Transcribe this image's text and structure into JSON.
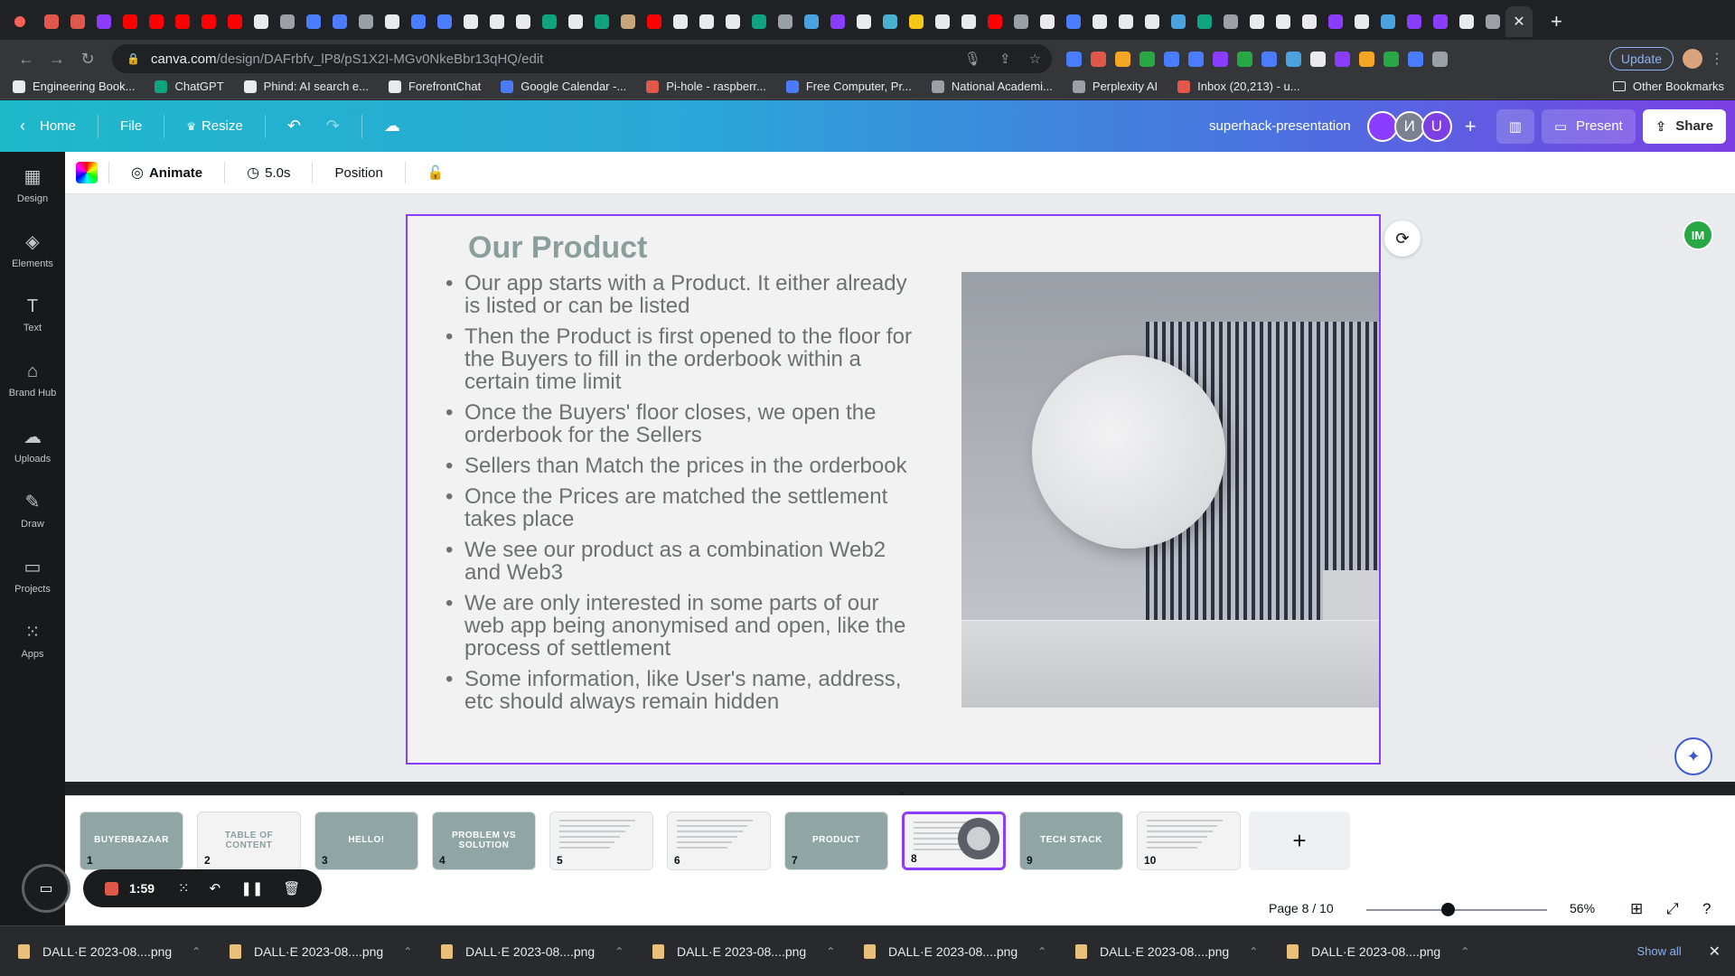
{
  "browser": {
    "url_host": "canva.com",
    "url_path": "/design/DAFrbfv_lP8/pS1X2I-MGv0NkeBbr13qHQ/edit",
    "update_label": "Update",
    "tab_favicon_colors": [
      "#e0584a",
      "#e0584a",
      "#8b3dff",
      "#ff0000",
      "#ff0000",
      "#ff0000",
      "#ff0000",
      "#ff0000",
      "#e8eaed",
      "#9aa0a6",
      "#4a7cff",
      "#4a7cff",
      "#9aa0a6",
      "#e8eaed",
      "#4a7cff",
      "#4a7cff",
      "#e8eaed",
      "#e8eaed",
      "#e8eaed",
      "#10a37f",
      "#e8eaed",
      "#10a37f",
      "#c9a67a",
      "#ff0000",
      "#e8eaed",
      "#e8eaed",
      "#e8eaed",
      "#10a37f",
      "#9aa0a6",
      "#4aa3df",
      "#8b3dff",
      "#e8eaed",
      "#4ab0d0",
      "#f5c518",
      "#e8eaed",
      "#e8eaed",
      "#ff0000",
      "#9aa0a6",
      "#e8eaed",
      "#4a7cff",
      "#e8eaed",
      "#e8eaed",
      "#e8eaed",
      "#4aa3df",
      "#10a37f",
      "#9aa0a6",
      "#e8eaed",
      "#e8eaed",
      "#e8eaed",
      "#8b3dff",
      "#e8eaed",
      "#4aa3df",
      "#8b3dff",
      "#8b3dff",
      "#e8eaed",
      "#9aa0a6"
    ],
    "extension_colors": [
      "#4a7cff",
      "#e0584a",
      "#f5a623",
      "#27a844",
      "#4a7cff",
      "#4a7cff",
      "#8b3dff",
      "#27a844",
      "#4a7cff",
      "#4aa3df",
      "#e8eaed",
      "#8b3dff",
      "#f5a623",
      "#27a844",
      "#4a7cff",
      "#9aa0a6"
    ]
  },
  "bookmarks": [
    {
      "label": "Engineering Book...",
      "color": "#e8eaed"
    },
    {
      "label": "ChatGPT",
      "color": "#10a37f"
    },
    {
      "label": "Phind: AI search e...",
      "color": "#e8eaed"
    },
    {
      "label": "ForefrontChat",
      "color": "#e8eaed"
    },
    {
      "label": "Google Calendar -...",
      "color": "#4a7cff"
    },
    {
      "label": "Pi-hole - raspberr...",
      "color": "#e0584a"
    },
    {
      "label": "Free Computer, Pr...",
      "color": "#4a7cff"
    },
    {
      "label": "National Academi...",
      "color": "#9aa0a6"
    },
    {
      "label": "Perplexity AI",
      "color": "#9aa0a6"
    },
    {
      "label": "Inbox (20,213) - u...",
      "color": "#e0584a"
    }
  ],
  "other_bookmarks": "Other Bookmarks",
  "canva_top": {
    "home": "Home",
    "file": "File",
    "resize": "Resize",
    "design_title": "superhack-presentation",
    "avatars": [
      {
        "initial": "",
        "color": "#8b3dff"
      },
      {
        "initial": "И",
        "color": "#7b8190"
      },
      {
        "initial": "U",
        "color": "#7b3fe4"
      }
    ],
    "add_label": "+",
    "present": "Present",
    "share": "Share"
  },
  "sidebar": [
    {
      "label": "Design",
      "icon": "▦"
    },
    {
      "label": "Elements",
      "icon": "◈"
    },
    {
      "label": "Text",
      "icon": "T"
    },
    {
      "label": "Brand Hub",
      "icon": "⌂"
    },
    {
      "label": "Uploads",
      "icon": "☁"
    },
    {
      "label": "Draw",
      "icon": "✎"
    },
    {
      "label": "Projects",
      "icon": "▭"
    },
    {
      "label": "Apps",
      "icon": "⁙"
    }
  ],
  "toolbar": {
    "animate": "Animate",
    "duration": "5.0s",
    "position": "Position"
  },
  "slide": {
    "title": "Our Product",
    "bullets": [
      "Our app starts with a Product. It either already is listed or can be listed",
      "Then the Product is first opened to the floor for the Buyers to fill in the orderbook within a certain time limit",
      "Once the Buyers' floor closes, we open the orderbook for the Sellers",
      "Sellers than Match the prices in the orderbook",
      "Once the Prices are matched the settlement takes place",
      "We see our product as a combination Web2 and Web3",
      "We are only interested in some parts of our web app being anonymised and open, like the process of settlement",
      "Some information, like User's name, address, etc should always remain hidden"
    ]
  },
  "collab_initials": "IM",
  "pages": [
    {
      "num": "1",
      "label": "BUYERBAZAAR",
      "style": "teal"
    },
    {
      "num": "2",
      "label": "TABLE OF CONTENT",
      "style": "light"
    },
    {
      "num": "3",
      "label": "HELLO!",
      "style": "teal"
    },
    {
      "num": "4",
      "label": "PROBLEM VS SOLUTION",
      "style": "teal"
    },
    {
      "num": "5",
      "label": "",
      "style": "lines"
    },
    {
      "num": "6",
      "label": "",
      "style": "lines"
    },
    {
      "num": "7",
      "label": "PRODUCT",
      "style": "teal"
    },
    {
      "num": "8",
      "label": "",
      "style": "active"
    },
    {
      "num": "9",
      "label": "TECH STACK",
      "style": "teal"
    },
    {
      "num": "10",
      "label": "",
      "style": "lines"
    }
  ],
  "page_indicator": "Page 8 / 10",
  "zoom": "56%",
  "zoom_fraction": 0.56,
  "recorder": {
    "time": "1:59"
  },
  "downloads": [
    "DALL·E 2023-08....png",
    "DALL·E 2023-08....png",
    "DALL·E 2023-08....png",
    "DALL·E 2023-08....png",
    "DALL·E 2023-08....png",
    "DALL·E 2023-08....png",
    "DALL·E 2023-08....png"
  ],
  "downloads_show_all": "Show all"
}
